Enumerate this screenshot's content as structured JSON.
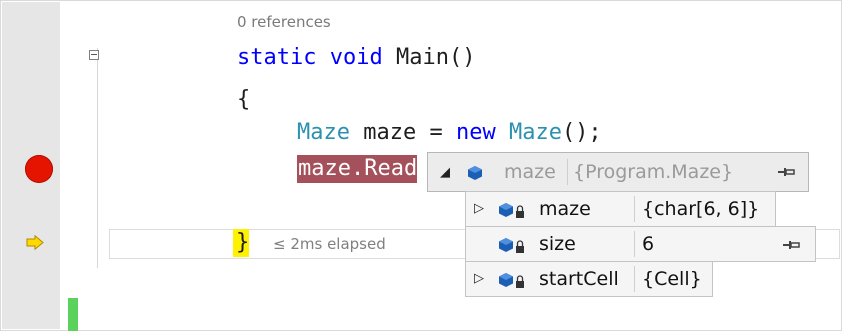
{
  "editor": {
    "codelens": "0 references",
    "lines": {
      "main_kw1": "static",
      "main_kw2": "void",
      "main_rest": " Main()",
      "open_brace": "{",
      "decl_type": "Maze",
      "decl_mid": " maze = ",
      "decl_new": "new",
      "decl_type2": "Maze",
      "decl_end": "();",
      "call_hl": "maze.Read",
      "close_brace": "}"
    },
    "elapsed": "≤ 2ms elapsed"
  },
  "datatip": {
    "header": {
      "name": "maze",
      "value": "{Program.Maze}"
    },
    "rows": [
      {
        "name": "maze",
        "value": "{char[6, 6]}",
        "expandable": true
      },
      {
        "name": "size",
        "value": "6",
        "expandable": false
      },
      {
        "name": "startCell",
        "value": "{Cell}",
        "expandable": true
      }
    ]
  },
  "colors": {
    "breakpoint": "#e51400",
    "instruction_pointer": "#ffd800",
    "highlight": "#a4515b",
    "keyword": "#0000ff",
    "type": "#2b91af"
  },
  "icons": {
    "breakpoint": "breakpoint-icon",
    "instruction_pointer": "current-statement-arrow-icon",
    "collapse": "outline-collapse-icon",
    "field": "private-field-icon",
    "pin": "pin-icon"
  }
}
